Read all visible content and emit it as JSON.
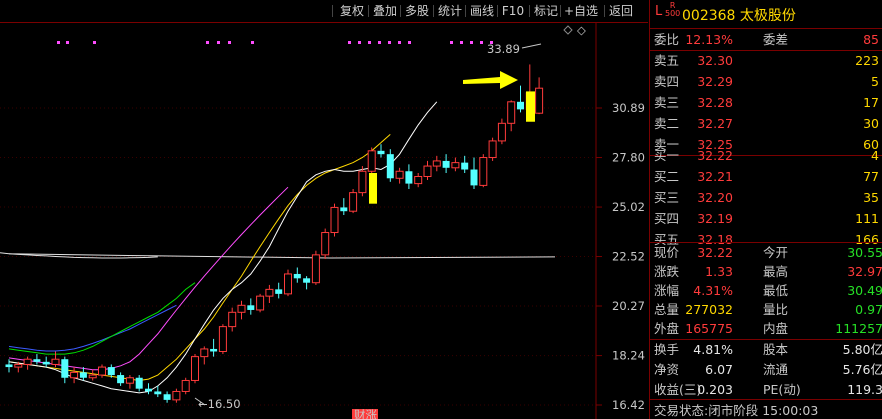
{
  "toolbar": {
    "items": [
      "复权",
      "叠加",
      "多股",
      "统计",
      "画线",
      "F10",
      "标记",
      "+自选",
      "返回"
    ]
  },
  "header": {
    "market_flag": "L",
    "level_flag": "R",
    "level_sub": "500",
    "code": "002368",
    "name": "太极股份",
    "title": "002368 太极股份"
  },
  "weibi": {
    "label1": "委比",
    "value1": "12.13%",
    "label2": "委差",
    "value2": "85"
  },
  "asks": [
    {
      "label": "卖五",
      "price": "32.30",
      "vol": "223"
    },
    {
      "label": "卖四",
      "price": "32.29",
      "vol": "5"
    },
    {
      "label": "卖三",
      "price": "32.28",
      "vol": "17"
    },
    {
      "label": "卖二",
      "price": "32.27",
      "vol": "30"
    },
    {
      "label": "卖一",
      "price": "32.25",
      "vol": "60"
    }
  ],
  "bids": [
    {
      "label": "买一",
      "price": "32.22",
      "vol": "4"
    },
    {
      "label": "买二",
      "price": "32.21",
      "vol": "77"
    },
    {
      "label": "买三",
      "price": "32.20",
      "vol": "35"
    },
    {
      "label": "买四",
      "price": "32.19",
      "vol": "111"
    },
    {
      "label": "买五",
      "price": "32.18",
      "vol": "166"
    }
  ],
  "quote": [
    {
      "l1": "现价",
      "v1": "32.22",
      "c1": "#ff3b3b",
      "l2": "今开",
      "v2": "30.55",
      "c2": "#26e026"
    },
    {
      "l1": "涨跌",
      "v1": "1.33",
      "c1": "#ff3b3b",
      "l2": "最高",
      "v2": "32.97",
      "c2": "#ff3b3b"
    },
    {
      "l1": "涨幅",
      "v1": "4.31%",
      "c1": "#ff3b3b",
      "l2": "最低",
      "v2": "30.49",
      "c2": "#26e026"
    },
    {
      "l1": "总量",
      "v1": "277032",
      "c1": "#ffd800",
      "l2": "量比",
      "v2": "0.97",
      "c2": "#26e026"
    },
    {
      "l1": "外盘",
      "v1": "165775",
      "c1": "#ff3b3b",
      "l2": "内盘",
      "v2": "111257",
      "c2": "#26e026"
    }
  ],
  "stats": [
    {
      "l1": "换手",
      "v1": "4.81%",
      "l2": "股本",
      "v2": "5.80亿"
    },
    {
      "l1": "净资",
      "v1": "6.07",
      "l2": "流通",
      "v2": "5.76亿"
    },
    {
      "l1": "收益(三)",
      "v1": "0.203",
      "l2": "PE(动)",
      "v2": "119.3"
    }
  ],
  "status": {
    "label": "交易状态:",
    "value": "闭市阶段 15:00:03"
  },
  "chart_data": {
    "type": "candlestick",
    "y_ticks": [
      "30.89",
      "27.80",
      "25.02",
      "22.52",
      "20.27",
      "18.24",
      "16.42"
    ],
    "annotations": {
      "high_label": "33.89",
      "low_label": "16.50",
      "bottom_tag": "财涨"
    },
    "colors": {
      "up": "#ff3b3b",
      "down": "#54ffff",
      "ma5": "#ffffff",
      "ma10": "#ffd800",
      "ma20": "#ff4dff",
      "ma60": "#00e000",
      "ma120": "#3b5bff",
      "ma250": "#e0e0e0",
      "highlight": "#ffff00",
      "arrow": "#ffff00"
    },
    "candles": [
      [
        17.9,
        18.1,
        17.6,
        17.8
      ],
      [
        17.8,
        18.0,
        17.6,
        17.9
      ],
      [
        17.9,
        18.2,
        17.7,
        18.1
      ],
      [
        18.1,
        18.3,
        17.9,
        18.0
      ],
      [
        18.0,
        18.2,
        17.8,
        17.9
      ],
      [
        17.9,
        18.4,
        17.8,
        18.1
      ],
      [
        18.1,
        18.2,
        17.2,
        17.4
      ],
      [
        17.4,
        17.8,
        17.2,
        17.6
      ],
      [
        17.6,
        17.8,
        17.3,
        17.4
      ],
      [
        17.4,
        17.7,
        17.3,
        17.5
      ],
      [
        17.5,
        17.9,
        17.4,
        17.8
      ],
      [
        17.8,
        17.9,
        17.4,
        17.5
      ],
      [
        17.5,
        17.6,
        17.1,
        17.2
      ],
      [
        17.2,
        17.5,
        17.0,
        17.4
      ],
      [
        17.4,
        17.5,
        16.9,
        17.0
      ],
      [
        17.0,
        17.2,
        16.8,
        16.9
      ],
      [
        16.9,
        17.1,
        16.7,
        16.8
      ],
      [
        16.8,
        16.9,
        16.5,
        16.6
      ],
      [
        16.6,
        17.0,
        16.5,
        16.9
      ],
      [
        16.9,
        17.4,
        16.8,
        17.3
      ],
      [
        17.3,
        18.3,
        17.2,
        18.2
      ],
      [
        18.2,
        18.6,
        17.9,
        18.5
      ],
      [
        18.5,
        18.9,
        18.2,
        18.4
      ],
      [
        18.4,
        19.5,
        18.3,
        19.4
      ],
      [
        19.4,
        20.2,
        19.2,
        20.0
      ],
      [
        20.0,
        20.5,
        19.7,
        20.3
      ],
      [
        20.3,
        20.6,
        19.9,
        20.1
      ],
      [
        20.1,
        20.8,
        20.0,
        20.7
      ],
      [
        20.7,
        21.2,
        20.4,
        21.0
      ],
      [
        21.0,
        21.3,
        20.6,
        20.8
      ],
      [
        20.8,
        21.9,
        20.7,
        21.7
      ],
      [
        21.7,
        22.0,
        21.3,
        21.5
      ],
      [
        21.5,
        21.6,
        21.0,
        21.3
      ],
      [
        21.3,
        22.8,
        21.2,
        22.6
      ],
      [
        22.6,
        23.9,
        22.4,
        23.7
      ],
      [
        23.7,
        25.2,
        23.5,
        25.0
      ],
      [
        25.0,
        25.5,
        24.6,
        24.8
      ],
      [
        24.8,
        26.0,
        24.7,
        25.8
      ],
      [
        25.8,
        27.3,
        25.6,
        27.0
      ],
      [
        27.0,
        28.4,
        26.8,
        28.2
      ],
      [
        28.2,
        28.6,
        27.8,
        28.0
      ],
      [
        28.0,
        28.3,
        26.4,
        26.6
      ],
      [
        26.6,
        27.2,
        26.3,
        27.0
      ],
      [
        27.0,
        27.4,
        26.0,
        26.3
      ],
      [
        26.3,
        26.9,
        26.1,
        26.7
      ],
      [
        26.7,
        27.6,
        26.5,
        27.3
      ],
      [
        27.3,
        27.9,
        27.0,
        27.6
      ],
      [
        27.6,
        28.0,
        26.9,
        27.2
      ],
      [
        27.2,
        27.8,
        27.0,
        27.5
      ],
      [
        27.5,
        27.9,
        26.9,
        27.1
      ],
      [
        27.1,
        27.8,
        26.0,
        26.2
      ],
      [
        26.2,
        28.0,
        26.1,
        27.8
      ],
      [
        27.8,
        29.0,
        27.6,
        28.8
      ],
      [
        28.8,
        30.2,
        28.6,
        29.9
      ],
      [
        29.9,
        31.4,
        29.4,
        31.3
      ],
      [
        31.3,
        32.4,
        30.6,
        30.8
      ],
      [
        30.8,
        33.89,
        30.7,
        31.9
      ],
      [
        30.55,
        32.97,
        30.49,
        32.22
      ]
    ],
    "highlight_bars": [
      {
        "low": 25.2,
        "high": 26.9
      },
      {
        "low": 30.0,
        "high": 32.0
      }
    ],
    "ma_lines": {
      "ma5": [
        18.0,
        17.95,
        17.9,
        17.85,
        17.8,
        17.7,
        17.55,
        17.4,
        17.3,
        17.2,
        17.1,
        17.0,
        16.95,
        16.9,
        16.85,
        16.9,
        17.1,
        17.4,
        17.8,
        18.3,
        18.9,
        19.5,
        20.1,
        20.6,
        21.0,
        21.3,
        21.7,
        22.3,
        23.0,
        23.9,
        24.8,
        25.6,
        26.4,
        26.8,
        27.0,
        27.1,
        27.0,
        27.0,
        27.1,
        27.2,
        27.1,
        27.4,
        28.0,
        28.9,
        29.8,
        30.6,
        31.3
      ],
      "ma10": [
        18.0,
        17.95,
        17.9,
        17.85,
        17.8,
        17.75,
        17.7,
        17.65,
        17.6,
        17.55,
        17.5,
        17.45,
        17.4,
        17.35,
        17.3,
        17.35,
        17.5,
        17.8,
        18.1,
        18.5,
        18.9,
        19.3,
        19.8,
        20.4,
        21.0,
        21.6,
        22.3,
        23.0,
        23.7,
        24.4,
        25.1,
        25.7,
        26.2,
        26.6,
        26.9,
        27.1,
        27.3,
        27.5,
        27.8,
        28.2,
        28.7,
        29.2
      ],
      "ma20": [
        18.15,
        18.1,
        18.05,
        18.0,
        17.95,
        17.9,
        17.85,
        17.8,
        17.75,
        17.7,
        17.7,
        17.75,
        17.85,
        18.0,
        18.3,
        18.7,
        19.1,
        19.6,
        20.1,
        20.6,
        21.1,
        21.6,
        22.1,
        22.6,
        23.1,
        23.6,
        24.1,
        24.6,
        25.1,
        25.6,
        26.1
      ],
      "ma60": [
        18.5,
        18.45,
        18.4,
        18.35,
        18.3,
        18.3,
        18.3,
        18.35,
        18.45,
        18.6,
        18.8,
        19.0,
        19.2,
        19.4,
        19.6,
        19.8,
        20.0,
        20.3,
        20.6,
        21.0,
        21.3
      ],
      "ma120": [
        18.6,
        18.55,
        18.5,
        18.45,
        18.42,
        18.42,
        18.45,
        18.5,
        18.6,
        18.72,
        18.85,
        19.0,
        19.15,
        19.3,
        19.5,
        19.7,
        19.9,
        20.1,
        20.3
      ],
      "ma250": [
        22.65,
        22.62,
        22.6,
        22.57,
        22.55,
        22.52,
        22.5,
        22.48,
        22.47,
        22.46,
        22.45,
        22.45,
        22.45,
        22.46,
        22.47,
        22.48,
        22.5
      ]
    }
  }
}
